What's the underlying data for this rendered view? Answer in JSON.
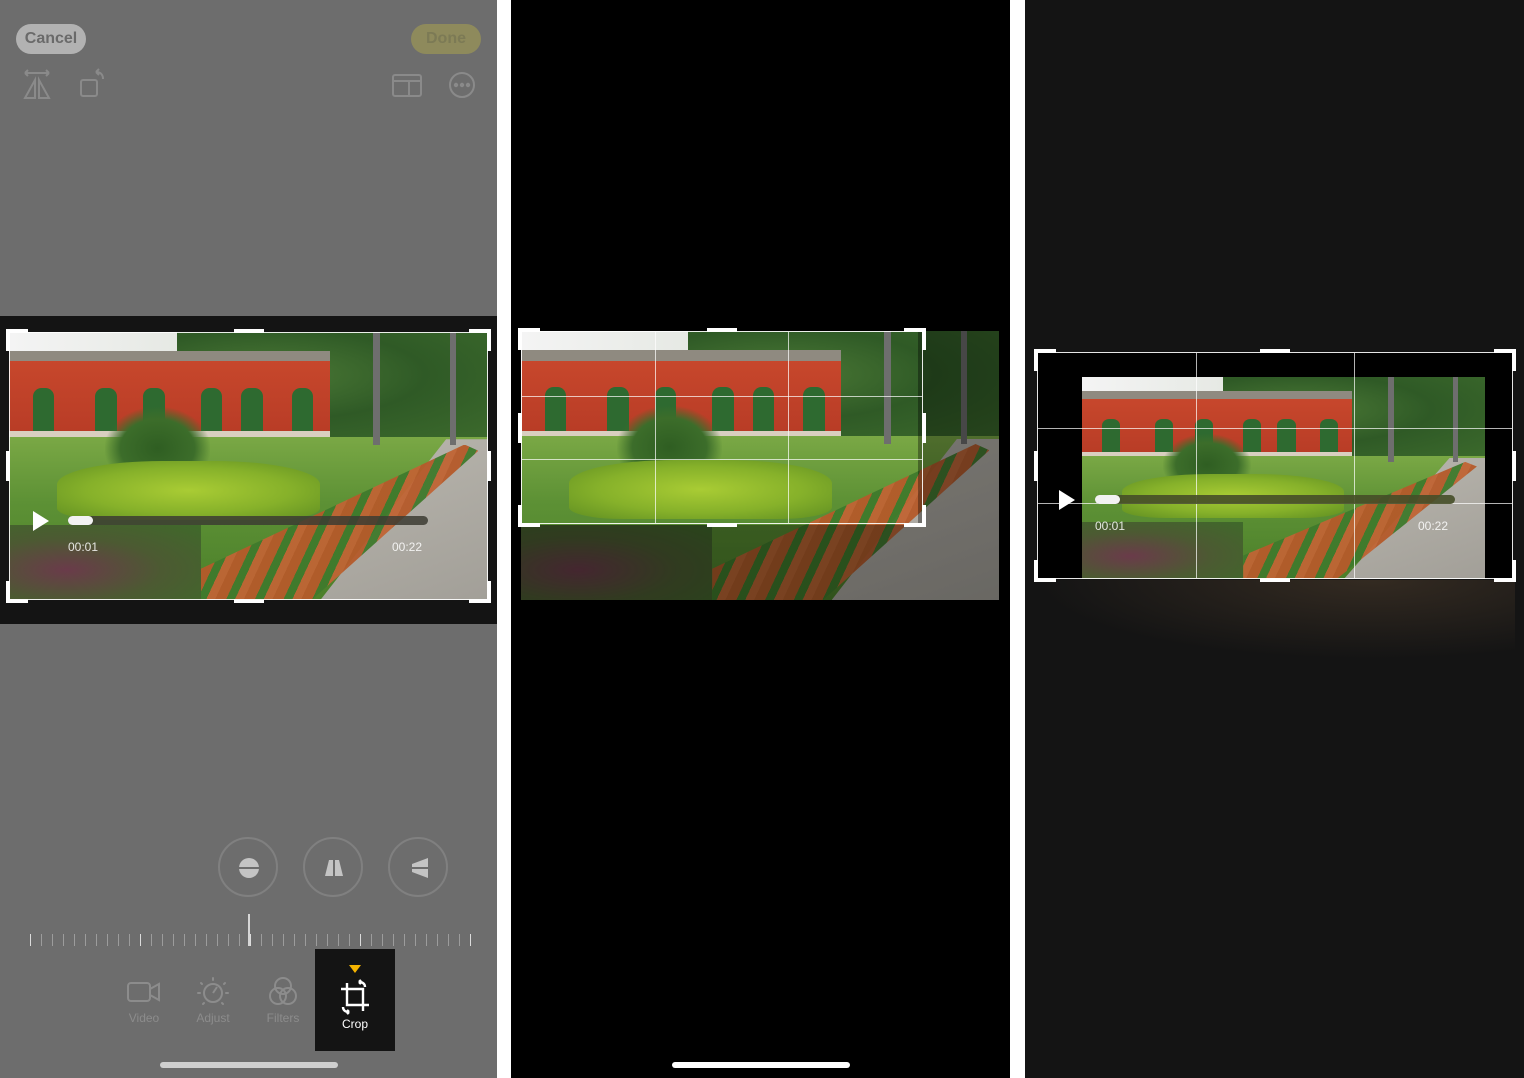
{
  "panels": [
    {
      "id": "crop-editor-dimmed",
      "header": {
        "cancel_label": "Cancel",
        "done_label": "Done",
        "icons_left": [
          "flip-horizontal-icon",
          "rotate-icon"
        ],
        "icons_right": [
          "aspect-ratio-icon",
          "more-options-icon"
        ]
      },
      "video": {
        "current_time": "00:01",
        "duration": "00:22",
        "progress": 0.07
      },
      "perspective_buttons": [
        "straighten-icon",
        "vertical-perspective-icon",
        "horizontal-perspective-icon"
      ],
      "ruler": {
        "value": 0
      },
      "tools": [
        {
          "label": "Video",
          "icon": "video-camera-icon",
          "active": false
        },
        {
          "label": "Adjust",
          "icon": "adjust-dial-icon",
          "active": false
        },
        {
          "label": "Filters",
          "icon": "filters-icon",
          "active": false
        },
        {
          "label": "Crop",
          "icon": "crop-rotate-icon",
          "active": true
        }
      ],
      "colors": {
        "active_indicator": "#f5b400",
        "background": "#6d6d6d"
      }
    },
    {
      "id": "crop-dragging",
      "crop_grid": "3x3"
    },
    {
      "id": "crop-result",
      "crop_grid": "3x3",
      "video": {
        "current_time": "00:01",
        "duration": "00:22",
        "progress": 0.07
      }
    }
  ]
}
